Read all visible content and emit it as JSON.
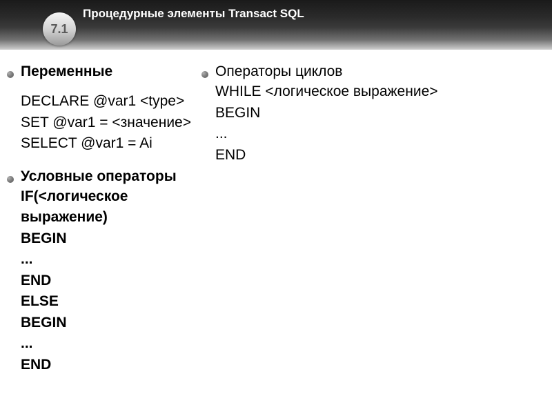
{
  "header": {
    "title": "Процедурные элементы Transact SQL",
    "badge": "7.1"
  },
  "left": {
    "section1": {
      "heading": "Переменные",
      "code": "DECLARE @var1 <type>\nSET @var1 = <значение>\nSELECT @var1 = Ai"
    },
    "section2": {
      "heading": "Условные операторы",
      "code": "IF(<логическое выражение)\nBEGIN\n...\nEND\nELSE\nBEGIN\n...\nEND"
    }
  },
  "right": {
    "section1": {
      "heading": "Операторы циклов",
      "code": "WHILE <логическое выражение>\nBEGIN\n...\nEND"
    }
  }
}
